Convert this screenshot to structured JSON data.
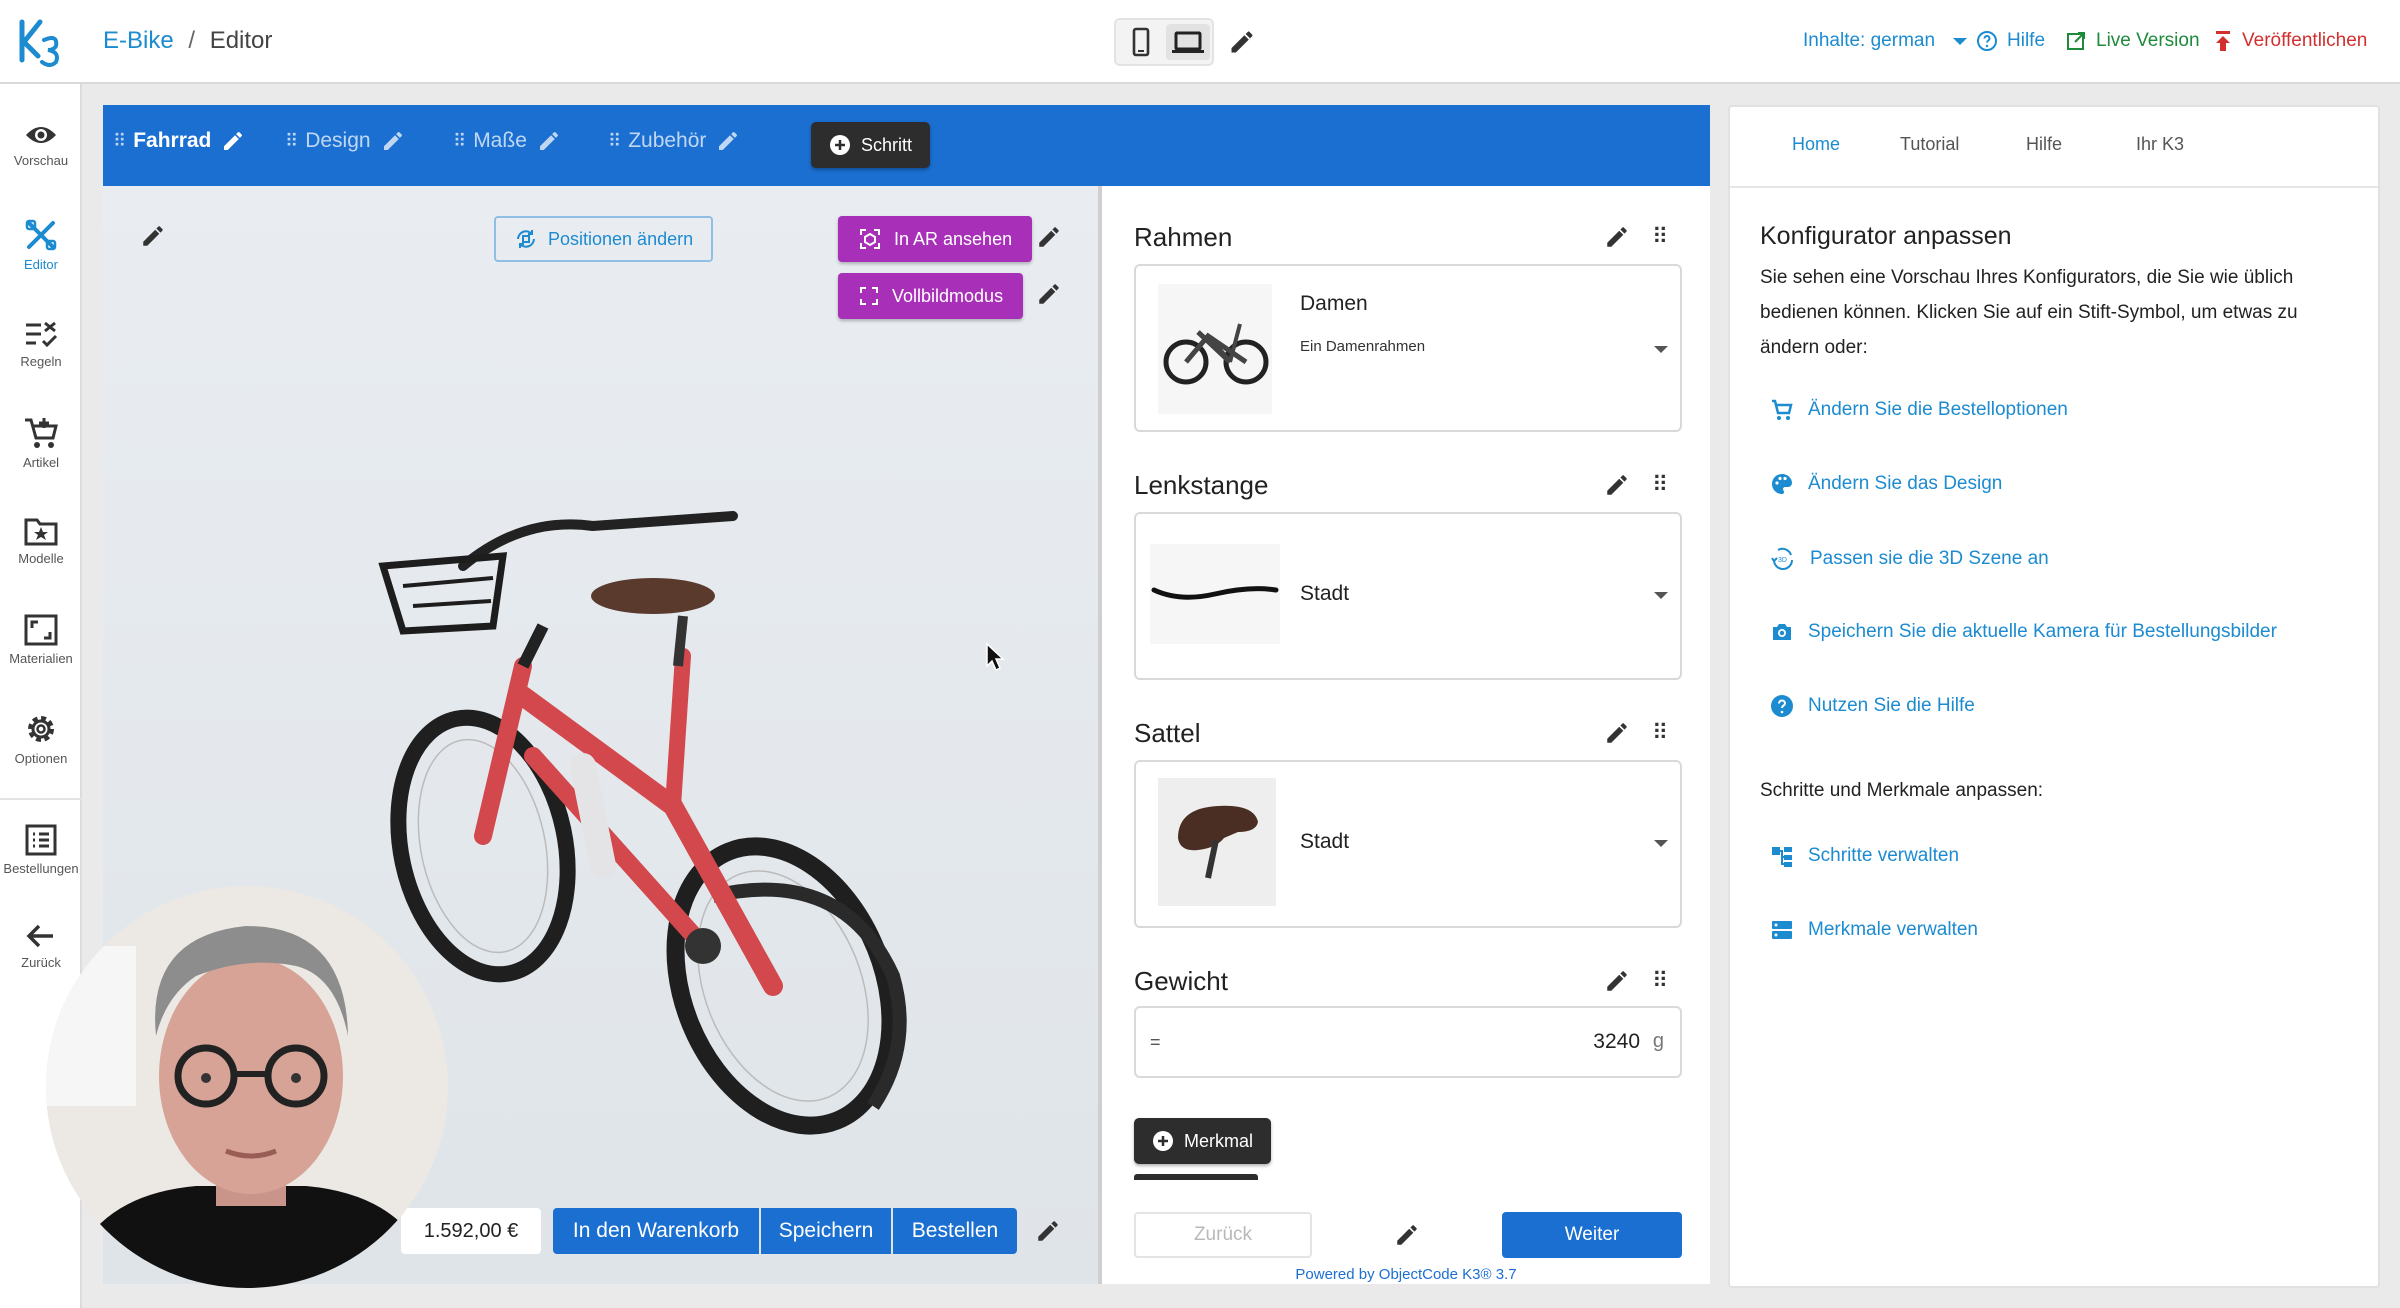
{
  "header": {
    "project": "E-Bike",
    "separator": "/",
    "page": "Editor",
    "language": "Inhalte: german",
    "help": "Hilfe",
    "live_version": "Live Version",
    "publish": "Veröffentlichen",
    "colors": {
      "brand": "#1c8bd0",
      "publish": "#d22f2f",
      "live": "#1e8a3c"
    }
  },
  "sidebar": {
    "items": [
      {
        "label": "Vorschau",
        "icon": "eye-icon"
      },
      {
        "label": "Editor",
        "icon": "tools-icon"
      },
      {
        "label": "Regeln",
        "icon": "rules-icon"
      },
      {
        "label": "Artikel",
        "icon": "cart-plus-icon"
      },
      {
        "label": "Modelle",
        "icon": "folder-star-icon"
      },
      {
        "label": "Materialien",
        "icon": "materials-icon"
      },
      {
        "label": "Optionen",
        "icon": "gear-icon"
      },
      {
        "label": "Bestellungen",
        "icon": "list-icon"
      },
      {
        "label": "Zurück",
        "icon": "arrow-left-icon"
      }
    ]
  },
  "steps": {
    "items": [
      "Fahrrad",
      "Design",
      "Maße",
      "Zubehör"
    ],
    "add_step": "Schritt"
  },
  "viewer": {
    "reposition": "Positionen ändern",
    "ar": "In AR ansehen",
    "fullscreen": "Vollbildmodus",
    "price": "1.592,00 €",
    "add_to_cart": "In den Warenkorb",
    "save": "Speichern",
    "order": "Bestellen"
  },
  "panel": {
    "frame": {
      "title": "Rahmen",
      "name": "Damen",
      "description": "Ein Damenrahmen"
    },
    "handlebar": {
      "title": "Lenkstange",
      "name": "Stadt"
    },
    "saddle": {
      "title": "Sattel",
      "name": "Stadt"
    },
    "weight": {
      "title": "Gewicht",
      "prefix": "=",
      "value": "3240",
      "unit": "g"
    },
    "add_feature": "Merkmal",
    "back": "Zurück",
    "next": "Weiter",
    "powered_by": "Powered by ObjectCode K3® 3.7"
  },
  "right": {
    "tabs": [
      "Home",
      "Tutorial",
      "Hilfe",
      "Ihr K3"
    ],
    "title": "Konfigurator anpassen",
    "intro": "Sie sehen eine Vorschau Ihres Konfigurators, die Sie wie üblich bedienen können. Klicken Sie auf ein Stift-Symbol, um etwas zu ändern oder:",
    "links": [
      {
        "label": "Ändern Sie die Bestelloptionen",
        "icon": "cart-icon"
      },
      {
        "label": "Ändern Sie das Design",
        "icon": "palette-icon"
      },
      {
        "label": "Passen sie die 3D Szene an",
        "icon": "3d-rotate-icon"
      },
      {
        "label": "Speichern Sie die aktuelle Kamera für Bestellungsbilder",
        "icon": "camera-icon"
      },
      {
        "label": "Nutzen Sie die Hilfe",
        "icon": "help-circle-icon"
      }
    ],
    "subtitle": "Schritte und Merkmale anpassen:",
    "links2": [
      {
        "label": "Schritte verwalten",
        "icon": "steps-icon"
      },
      {
        "label": "Merkmale verwalten",
        "icon": "features-icon"
      }
    ]
  }
}
